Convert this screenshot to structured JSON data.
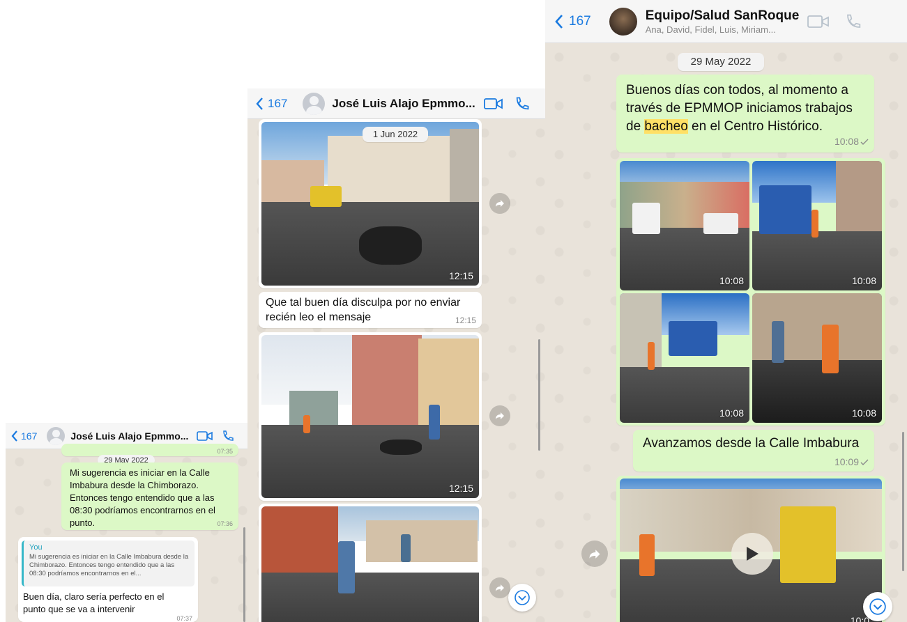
{
  "left_panel": {
    "header": {
      "back_count": "167",
      "title": "José Luis Alajo Epmmo..."
    },
    "prev_time": "07:35",
    "date_pill": "29 May 2022",
    "outgoing": {
      "text": "Mi sugerencia es iniciar en la Calle Imbabura desde la Chimborazo. Entonces tengo entendido que a las 08:30 podríamos encontrarnos en el punto.",
      "time": "07:36"
    },
    "reply": {
      "quote_author": "You",
      "quote_text": "Mi sugerencia es iniciar en la Calle Imbabura desde la Chimborazo. Entonces tengo entendido que a las 08:30 podríamos encontrarnos en el...",
      "text": "Buen día, claro sería perfecto en el punto que se va a intervenir",
      "time": "07:37"
    }
  },
  "middle_panel": {
    "header": {
      "back_count": "167",
      "title": "José Luis Alajo Epmmo..."
    },
    "date_pill": "1 Jun 2022",
    "photo1_time": "12:15",
    "text_message": {
      "text": "Que tal buen día disculpa por no enviar recién leo el mensaje",
      "time": "12:15"
    },
    "photo2_time": "12:15"
  },
  "right_panel": {
    "header": {
      "back_count": "167",
      "title": "Equipo/Salud SanRoque",
      "subtitle": "Ana, David, Fidel, Luis, Miriam..."
    },
    "date_pill": "29 May 2022",
    "message1": {
      "text_before": "Buenos días con todos, al momento a través de EPMMOP iniciamos trabajos de ",
      "highlight": "bacheo",
      "text_after": " en el Centro Histórico.",
      "time": "10:08"
    },
    "grid_times": [
      "10:08",
      "10:08",
      "10:08",
      "10:08"
    ],
    "message2": {
      "text": "Avanzamos desde la Calle Imbabura",
      "time": "10:09"
    },
    "video_time_partial": "10:0"
  },
  "colors": {
    "accent": "#1a7ae0",
    "outgoing_bubble": "#dcf8c6",
    "highlight": "#ffe066"
  }
}
